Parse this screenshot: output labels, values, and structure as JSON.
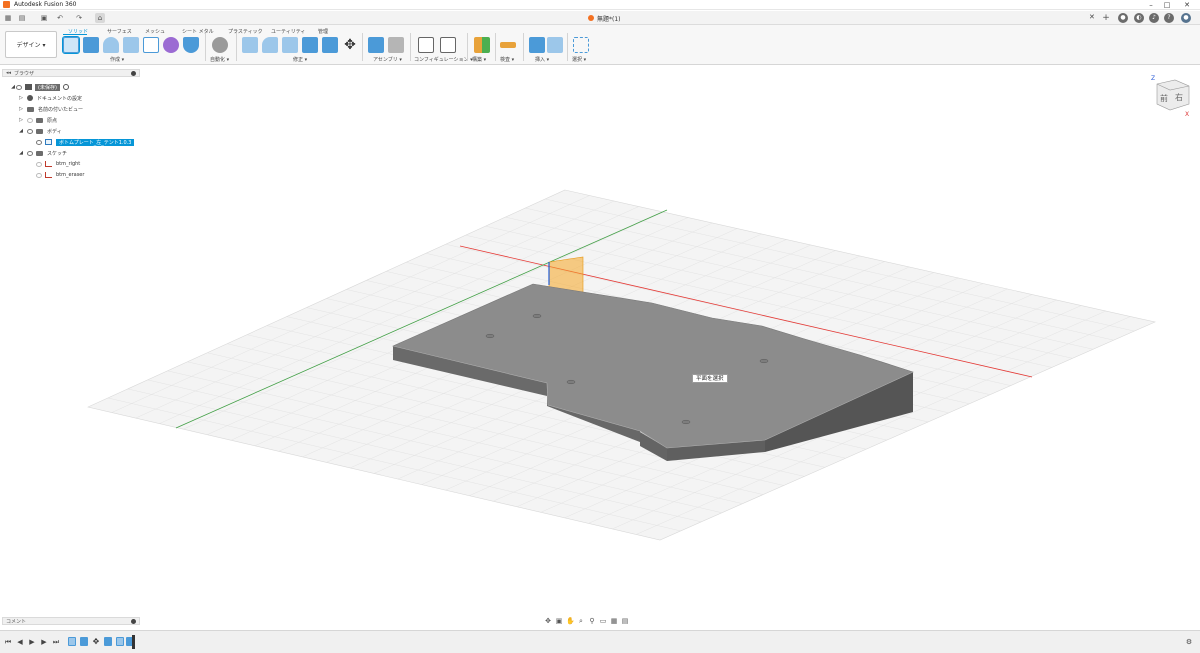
{
  "window": {
    "app_title": "Autodesk Fusion 360",
    "controls": [
      "–",
      "□",
      "✕"
    ]
  },
  "document": {
    "tab_title": "無題*(1)"
  },
  "ribbon": {
    "workspace_label": "デザイン ▾",
    "tabs": [
      "ソリッド",
      "サーフェス",
      "メッシュ",
      "シート メタル",
      "プラスティック",
      "ユーティリティ",
      "管理"
    ],
    "groups": [
      "作成 ▾",
      "自動化 ▾",
      "修正 ▾",
      "アセンブリ ▾",
      "コンフィギュレーション ▾",
      "構築 ▾",
      "検査 ▾",
      "挿入 ▾",
      "選択 ▾"
    ]
  },
  "browser": {
    "title": "ブラウザ",
    "root": "(未保存)",
    "items": [
      {
        "label": "ドキュメントの設定"
      },
      {
        "label": "名前の付いたビュー"
      },
      {
        "label": "原点"
      },
      {
        "label": "ボディ"
      },
      {
        "label": "ボトムプレート_左_テント1.0.3"
      },
      {
        "label": "スケッチ"
      },
      {
        "label": "btm_right"
      },
      {
        "label": "btm_eraser"
      }
    ]
  },
  "comments": {
    "title": "コメント"
  },
  "viewport": {
    "tooltip": "平面を選択",
    "viewcube_front": "前",
    "viewcube_right": "右",
    "axis_z": "Z",
    "axis_x": "X"
  },
  "colors": {
    "accent": "#0696d7",
    "x_axis": "#e53935",
    "y_axis": "#43a047",
    "body_top": "#8c8c8c",
    "body_side": "#6a6a6a",
    "sketch_plane": "#f5a623"
  }
}
